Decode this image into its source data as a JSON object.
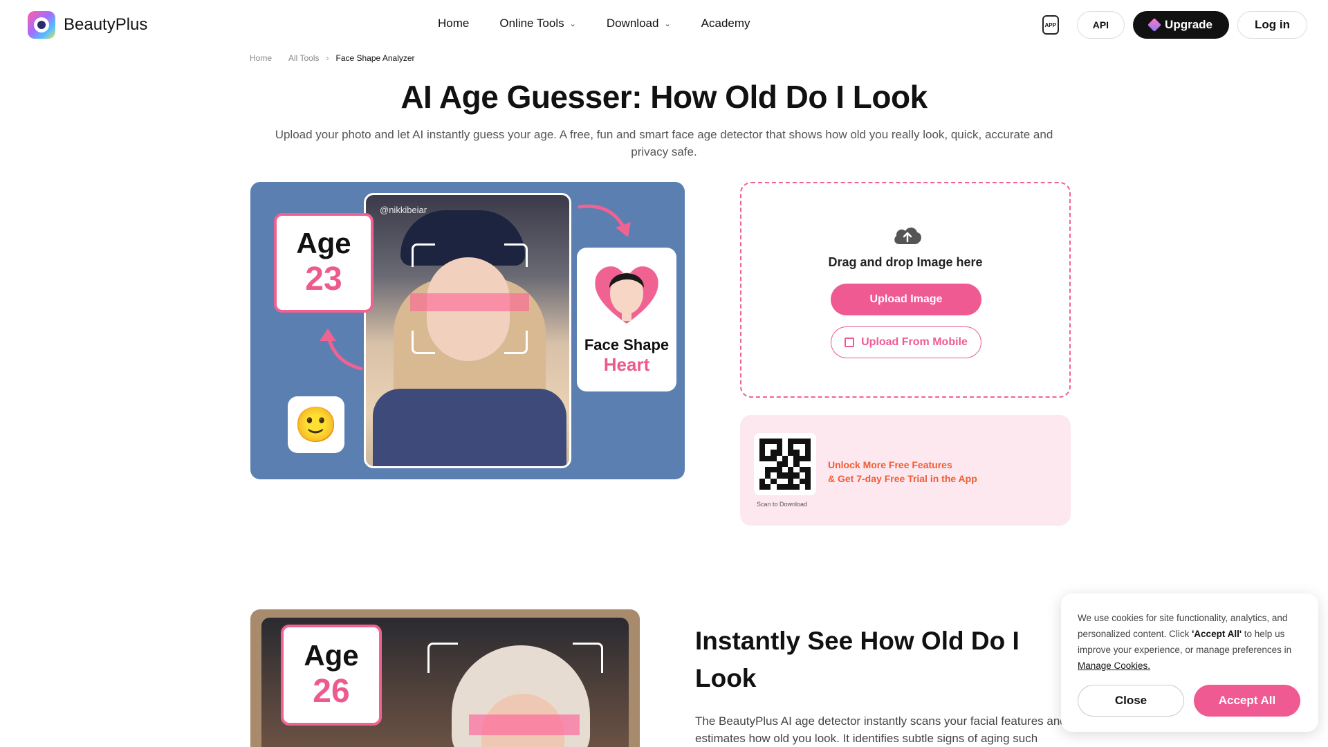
{
  "brand": {
    "name": "BeautyPlus"
  },
  "nav": {
    "links": [
      {
        "label": "Home"
      },
      {
        "label": "Online Tools"
      },
      {
        "label": "Download"
      },
      {
        "label": "Academy"
      }
    ],
    "app_badge": "APP",
    "api_label": "API",
    "upgrade_label": "Upgrade",
    "login_label": "Log in"
  },
  "breadcrumb": {
    "items": [
      "Home",
      "All Tools",
      "Face Shape Analyzer"
    ]
  },
  "page": {
    "title": "AI Age Guesser: How Old Do I Look",
    "subtitle": "Upload your photo and let AI instantly guess your age. A free, fun and smart face age detector that shows how old you really look, quick, accurate and privacy safe."
  },
  "hero": {
    "handle": "@nikkibeiar",
    "age_label": "Age",
    "age_value": "23",
    "emoji": "🙂",
    "face_shape_label": "Face Shape",
    "face_shape_value": "Heart"
  },
  "upload": {
    "drag_text": "Drag and drop Image here",
    "upload_button": "Upload Image",
    "mobile_button": "Upload From Mobile"
  },
  "promo": {
    "scan_text": "Scan to Download",
    "line1": "Unlock More Free Features",
    "line2": "& Get 7-day Free Trial in the App"
  },
  "section2": {
    "age_label": "Age",
    "age_value": "26",
    "title": "Instantly See How Old Do I Look",
    "body": "The BeautyPlus AI age detector instantly scans your facial features and estimates how old you look. It identifies subtle signs of aging such"
  },
  "cookie": {
    "text_part1": "We use cookies for site functionality, analytics, and personalized content. Click ",
    "text_bold": "'Accept All'",
    "text_part2": " to help us improve your experience, or manage preferences in ",
    "manage_link": "Manage Cookies.",
    "close_label": "Close",
    "accept_label": "Accept All"
  },
  "colors": {
    "accent": "#f05a93",
    "hero_bg": "#5a7fb0",
    "promo_bg": "#fde8ef",
    "promo_text": "#f25b33"
  }
}
